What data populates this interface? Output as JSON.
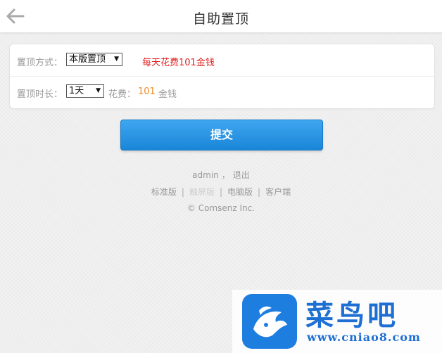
{
  "header": {
    "title": "自助置顶",
    "back_icon": "arrow-left-icon"
  },
  "form": {
    "mode_label": "置顶方式：",
    "mode_value": "本版置顶",
    "mode_note": "每天花费101金钱",
    "duration_label": "置顶时长：",
    "duration_value": "1天",
    "cost_label": "花费：",
    "cost_amount": "101",
    "cost_unit": "金钱"
  },
  "actions": {
    "submit_label": "提交"
  },
  "footer": {
    "username": "admin",
    "comma": "，",
    "logout": "退出",
    "links": [
      "标准版",
      "触屏版",
      "电脑版",
      "客户端"
    ],
    "separator": "|",
    "copyright": "© Comsenz Inc."
  },
  "watermark": {
    "brand": "菜鸟吧",
    "url": "www.cniao8.com"
  },
  "colors": {
    "accent": "#1a86d8",
    "note_red": "#e02020",
    "cost_orange": "#f08a24",
    "watermark_blue": "#1e6fd4"
  }
}
